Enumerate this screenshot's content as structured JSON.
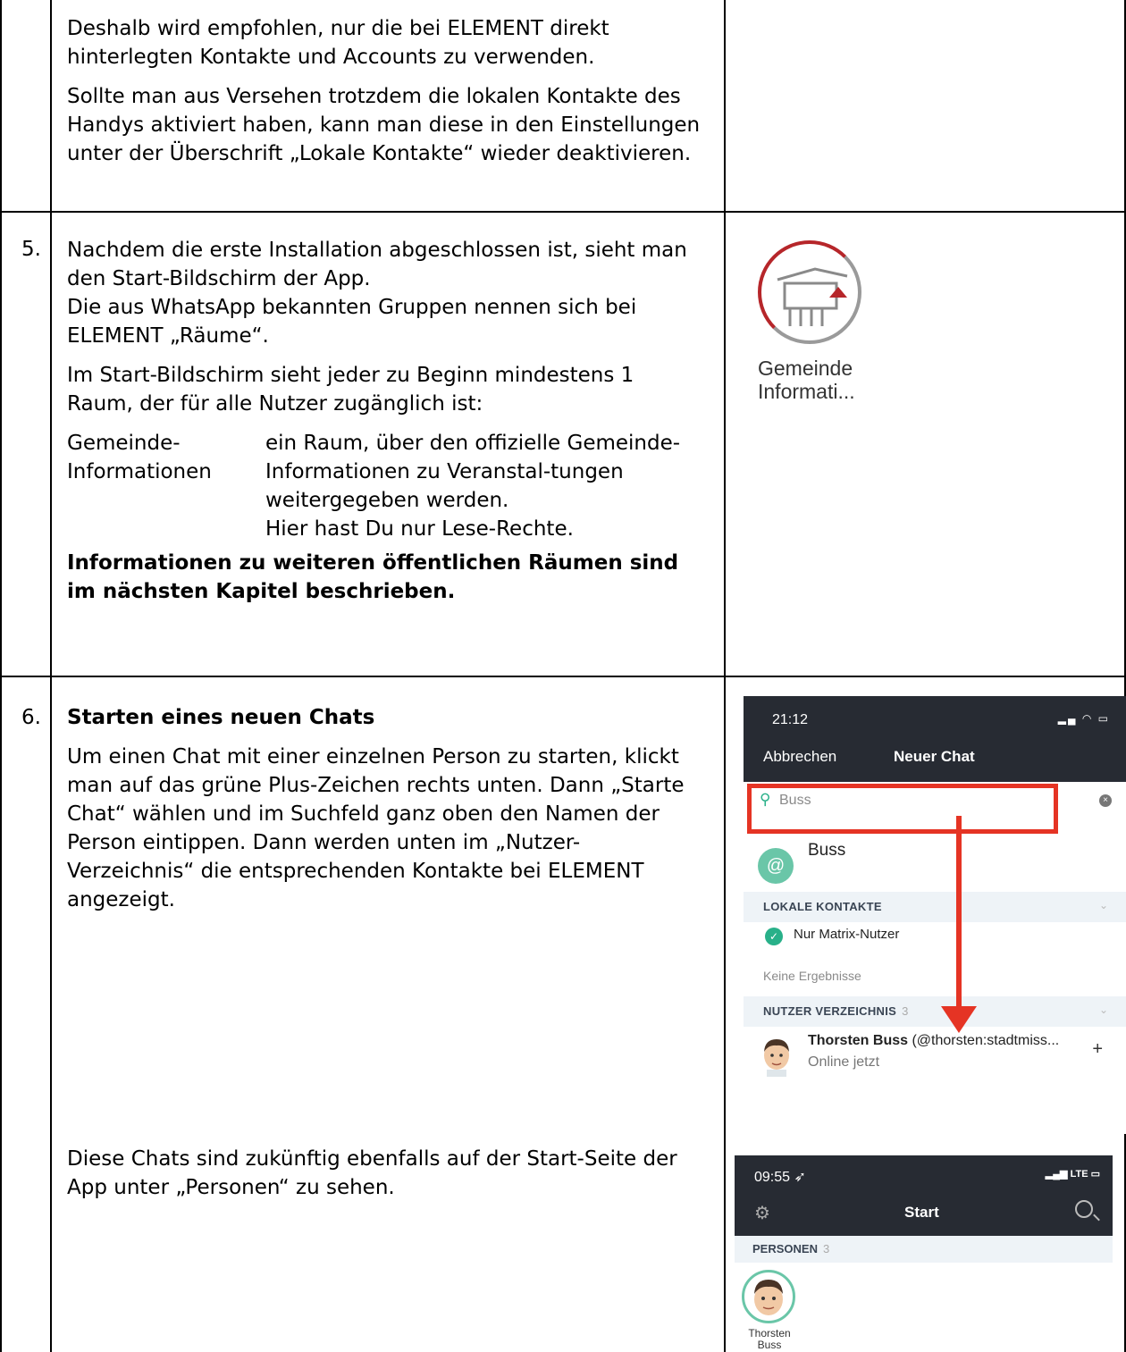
{
  "row_top": {
    "para1": "Deshalb wird empfohlen, nur die bei ELEMENT direkt hinterlegten Kontakte und Accounts zu verwenden.",
    "para2": "Sollte man aus Versehen trotzdem die lokalen Kontakte des Handys aktiviert haben, kann man diese in den Einstellungen unter der Überschrift „Lokale Kontakte“ wieder deaktivieren."
  },
  "row5": {
    "number": "5.",
    "para1a": "Nachdem die erste Installation abgeschlossen ist, sieht man den Start-Bildschirm der App.",
    "para1b": "Die aus WhatsApp bekannten Gruppen nennen sich bei ELEMENT „Räume“.",
    "para2": "Im Start-Bildschirm sieht jeder zu Beginn mindestens 1 Raum, der für alle Nutzer zugänglich ist:",
    "def_term": "Gemeinde-Informationen",
    "def_desc_1": "ein Raum, über den offizielle Gemeinde-Informationen zu Veranstal-tungen weitergegeben werden.",
    "def_desc_2": "Hier hast Du nur Lese-Rechte.",
    "bold_note": "Informationen zu weiteren öffentlichen Räumen sind im nächsten Kapitel beschrieben.",
    "app_icon_label": "Gemeinde Informati..."
  },
  "row6": {
    "number": "6.",
    "heading": "Starten eines neuen Chats",
    "para1": "Um einen Chat mit einer einzelnen Person zu starten, klickt man auf das grüne Plus-Zeichen rechts unten. Dann „Starte Chat“ wählen und im Suchfeld ganz oben den Namen der Person eintippen. Dann werden unten im „Nutzer-Verzeichnis“ die entsprechenden Kontakte bei ELEMENT angezeigt.",
    "para2": "Diese Chats sind zukünftig ebenfalls auf der Start-Seite der App unter „Personen“ zu sehen."
  },
  "phone_new_chat": {
    "time": "21:12",
    "cancel": "Abbrechen",
    "title": "Neuer Chat",
    "search_value": "Buss",
    "at_result": "Buss",
    "section_local": "LOKALE KONTAKTE",
    "matrix_only": "Nur Matrix-Nutzer",
    "no_results": "Keine Ergebnisse",
    "section_directory": "NUTZER VERZEICHNIS",
    "directory_count": "3",
    "user_name": "Thorsten Buss",
    "user_id": "(@thorsten:stadtmiss...",
    "user_status": "Online jetzt",
    "highlight_color": "#e53424"
  },
  "phone_start": {
    "time": "09:55",
    "network": "LTE",
    "title": "Start",
    "section_people": "PERSONEN",
    "people_count": "3",
    "person_name": "Thorsten Buss"
  }
}
